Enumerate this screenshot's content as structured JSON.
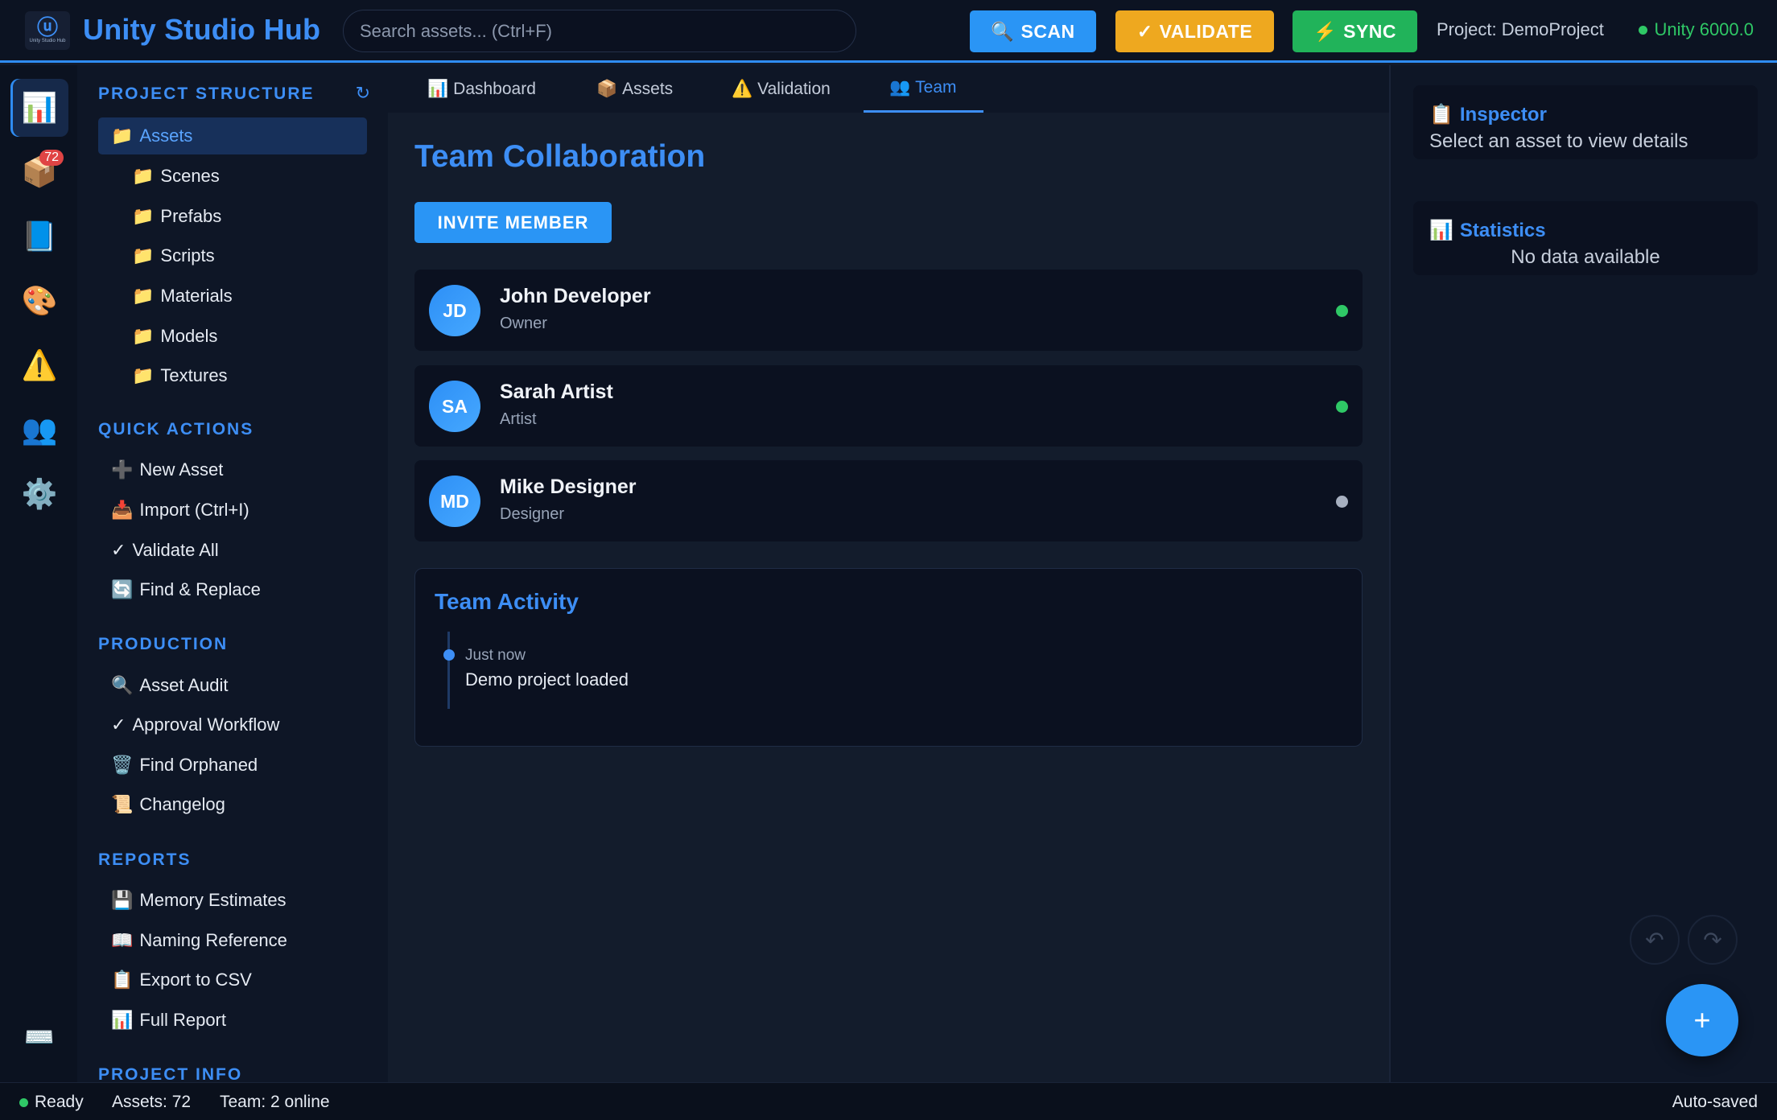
{
  "header": {
    "title": "Unity Studio Hub",
    "logo_text": "Unity Studio Hub",
    "search_placeholder": "Search assets... (Ctrl+F)",
    "buttons": {
      "scan": {
        "icon": "🔍",
        "label": "SCAN"
      },
      "validate": {
        "icon": "✓",
        "label": "VALIDATE"
      },
      "sync": {
        "icon": "⚡",
        "label": "SYNC"
      }
    },
    "project": "Project: DemoProject",
    "unity_version": "Unity 6000.0"
  },
  "rail": {
    "items": [
      {
        "icon": "📊",
        "name": "dashboard"
      },
      {
        "icon": "📦",
        "name": "assets",
        "badge": "72"
      },
      {
        "icon": "📘",
        "name": "docs"
      },
      {
        "icon": "🎨",
        "name": "art"
      },
      {
        "icon": "⚠️",
        "name": "validation"
      },
      {
        "icon": "👥",
        "name": "team"
      },
      {
        "icon": "⚙️",
        "name": "settings"
      }
    ],
    "keyboard_icon": "⌨️"
  },
  "sidebar": {
    "project_structure": {
      "title": "PROJECT STRUCTURE",
      "refresh_icon": "↻",
      "root": {
        "icon": "📁",
        "label": "Assets"
      },
      "folders": [
        {
          "icon": "📁",
          "label": "Scenes"
        },
        {
          "icon": "📁",
          "label": "Prefabs"
        },
        {
          "icon": "📁",
          "label": "Scripts"
        },
        {
          "icon": "📁",
          "label": "Materials"
        },
        {
          "icon": "📁",
          "label": "Models"
        },
        {
          "icon": "📁",
          "label": "Textures"
        }
      ]
    },
    "quick_actions": {
      "title": "QUICK ACTIONS",
      "items": [
        {
          "icon": "➕",
          "label": "New Asset"
        },
        {
          "icon": "📥",
          "label": "Import (Ctrl+I)"
        },
        {
          "icon": "✓",
          "label": "Validate All"
        },
        {
          "icon": "🔄",
          "label": "Find & Replace"
        }
      ]
    },
    "production": {
      "title": "PRODUCTION",
      "items": [
        {
          "icon": "🔍",
          "label": "Asset Audit"
        },
        {
          "icon": "✓",
          "label": "Approval Workflow"
        },
        {
          "icon": "🗑️",
          "label": "Find Orphaned"
        },
        {
          "icon": "📜",
          "label": "Changelog"
        }
      ]
    },
    "reports": {
      "title": "REPORTS",
      "items": [
        {
          "icon": "💾",
          "label": "Memory Estimates"
        },
        {
          "icon": "📖",
          "label": "Naming Reference"
        },
        {
          "icon": "📋",
          "label": "Export to CSV"
        },
        {
          "icon": "📊",
          "label": "Full Report"
        }
      ]
    },
    "project_info": {
      "title": "PROJECT INFO"
    }
  },
  "main": {
    "tabs": [
      {
        "icon": "📊",
        "label": "Dashboard"
      },
      {
        "icon": "📦",
        "label": "Assets"
      },
      {
        "icon": "⚠️",
        "label": "Validation"
      },
      {
        "icon": "👥",
        "label": "Team",
        "active": true
      }
    ],
    "title": "Team Collaboration",
    "invite_label": "INVITE MEMBER",
    "members": [
      {
        "initials": "JD",
        "name": "John Developer",
        "role": "Owner",
        "status": "online",
        "status_color": "#2fc866"
      },
      {
        "initials": "SA",
        "name": "Sarah Artist",
        "role": "Artist",
        "status": "online",
        "status_color": "#2fc866"
      },
      {
        "initials": "MD",
        "name": "Mike Designer",
        "role": "Designer",
        "status": "offline",
        "status_color": "#a7b0c0"
      }
    ],
    "activity": {
      "title": "Team Activity",
      "entries": [
        {
          "time": "Just now",
          "text": "Demo project loaded"
        }
      ]
    }
  },
  "inspector": {
    "icon": "📋",
    "title": "Inspector",
    "body": "Select an asset to view details"
  },
  "statistics": {
    "icon": "📊",
    "title": "Statistics",
    "body": "No data available"
  },
  "controls": {
    "undo": "↶",
    "redo": "↷",
    "fab": "+"
  },
  "statusbar": {
    "ready": "Ready",
    "assets": "Assets: 72",
    "team": "Team: 2 online",
    "autosave": "Auto-saved"
  },
  "colors": {
    "accent": "#3d8ef5",
    "online": "#2fc866",
    "warning": "#eea81f",
    "success": "#21b35a"
  }
}
